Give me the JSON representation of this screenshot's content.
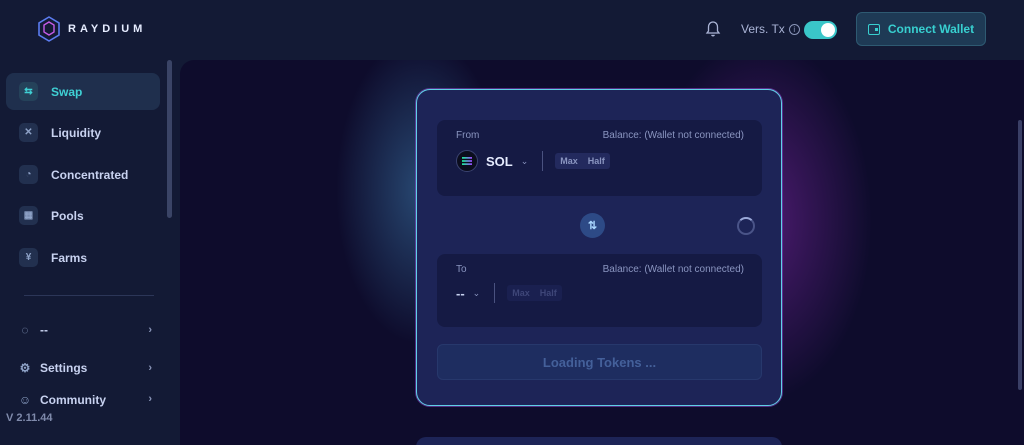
{
  "app": {
    "brand": "RAYDIUM",
    "version": "V 2.11.44"
  },
  "header": {
    "vers_tx_label": "Vers. Tx",
    "vers_tx_enabled": true,
    "connect_wallet_label": "Connect Wallet"
  },
  "sidebar": {
    "items": [
      {
        "label": "Swap",
        "icon": "swap-icon",
        "active": true
      },
      {
        "label": "Liquidity",
        "icon": "liquidity-icon",
        "active": false
      },
      {
        "label": "Concentrated",
        "icon": "concentrated-icon",
        "active": false
      },
      {
        "label": "Pools",
        "icon": "pools-icon",
        "active": false
      },
      {
        "label": "Farms",
        "icon": "farms-icon",
        "active": false
      }
    ],
    "sub_items": [
      {
        "label": "--",
        "icon": "rpc-icon"
      },
      {
        "label": "Settings",
        "icon": "settings-icon"
      },
      {
        "label": "Community",
        "icon": "community-icon"
      }
    ]
  },
  "swap": {
    "from": {
      "label": "From",
      "balance": "Balance: (Wallet not connected)",
      "token": "SOL",
      "max_label": "Max",
      "half_label": "Half"
    },
    "to": {
      "label": "To",
      "balance": "Balance: (Wallet not connected)",
      "token": "--",
      "max_label": "Max",
      "half_label": "Half"
    },
    "action_label": "Loading Tokens ..."
  },
  "colors": {
    "accent": "#3fd0d4",
    "background": "#131a35",
    "card_border": "#5fd0e6"
  }
}
